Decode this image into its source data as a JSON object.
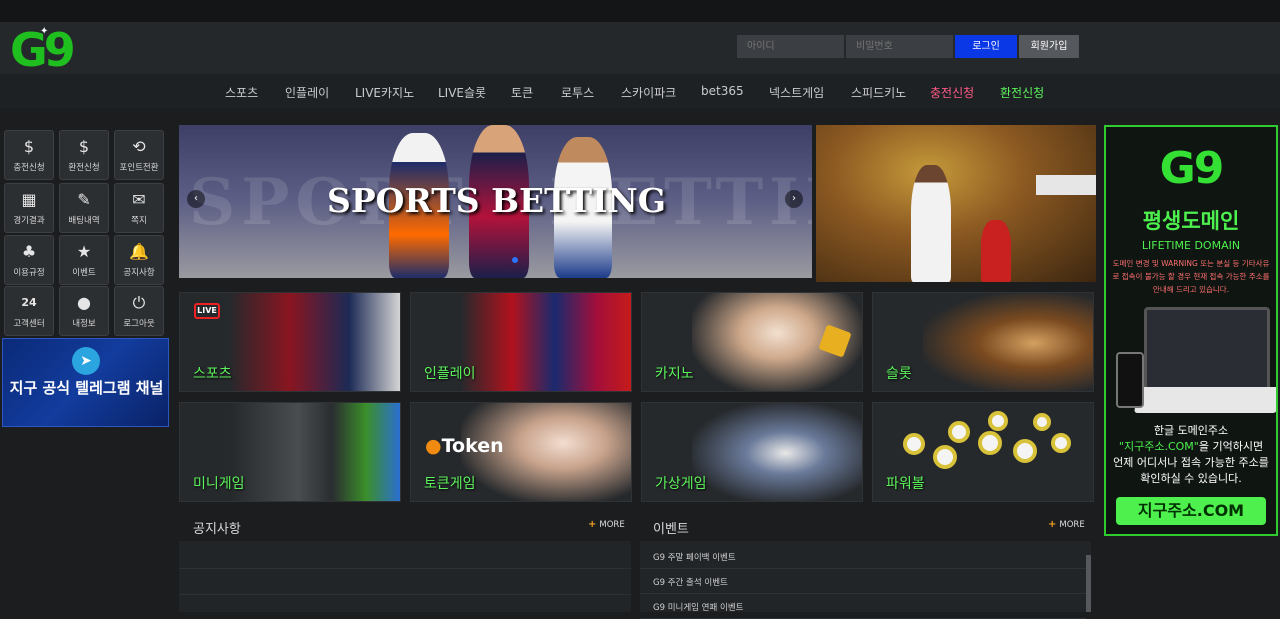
{
  "header": {
    "logo": "G9",
    "id_placeholder": "아이디",
    "pw_placeholder": "비밀번호",
    "login_label": "로그인",
    "join_label": "회원가입"
  },
  "nav": {
    "items": [
      "스포츠",
      "인플레이",
      "LIVE카지노",
      "LIVE슬롯",
      "토큰",
      "로투스",
      "스카이파크",
      "bet365",
      "넥스트게임",
      "스피드키노",
      "충전신청",
      "환전신청"
    ]
  },
  "sidebar": {
    "buttons": [
      {
        "label": "충전신청",
        "icon": "coin-deposit-icon",
        "glyph": "$"
      },
      {
        "label": "환전신청",
        "icon": "exchange-icon",
        "glyph": "$"
      },
      {
        "label": "포인트전환",
        "icon": "point-convert-icon",
        "glyph": "⟲"
      },
      {
        "label": "경기결과",
        "icon": "calendar-icon",
        "glyph": "▦"
      },
      {
        "label": "배팅내역",
        "icon": "bet-history-icon",
        "glyph": "✎"
      },
      {
        "label": "쪽지",
        "icon": "mail-icon",
        "glyph": "✉"
      },
      {
        "label": "이용규정",
        "icon": "clover-icon",
        "glyph": "♣"
      },
      {
        "label": "이벤트",
        "icon": "star-icon",
        "glyph": "★"
      },
      {
        "label": "공지사항",
        "icon": "bell-icon",
        "glyph": "🔔"
      },
      {
        "label": "고객센터",
        "icon": "support-24-7-icon",
        "glyph": "24"
      },
      {
        "label": "내정보",
        "icon": "user-icon",
        "glyph": "●"
      },
      {
        "label": "로그아웃",
        "icon": "power-icon",
        "glyph": "⏻"
      }
    ],
    "telegram_banner": "지구 공식 텔레그램 채널"
  },
  "slider": {
    "title": "SPORTS BETTING",
    "bg_text": "SPORTS BETTING",
    "prev": "‹",
    "next": "›"
  },
  "cards": [
    {
      "label": "스포츠",
      "live": "LIVE"
    },
    {
      "label": "인플레이"
    },
    {
      "label": "카지노"
    },
    {
      "label": "슬롯"
    },
    {
      "label": "미니게임"
    },
    {
      "label": "토큰게임",
      "brand": "Token"
    },
    {
      "label": "가상게임"
    },
    {
      "label": "파워볼"
    }
  ],
  "right_banner": {
    "logo": "G9",
    "title": "평생도메인",
    "subtitle": "LIFETIME DOMAIN",
    "warning": "도메인 변경 및 WARNING 또는 분실 등 기타사유로 접속이 불가능 할 경우 현재 접속 가능한 주소를 안내해 드리고 있습니다.",
    "info_line1": "한글 도메인주소",
    "info_line2_hl": "\"지구주소.COM\"",
    "info_line2": "을 기억하시면",
    "info_line3": "언제 어디서나 접속 가능한 주소를",
    "info_line4": "확인하실 수 있습니다.",
    "url": "지구주소.COM"
  },
  "notice": {
    "title": "공지사항",
    "more": "MORE"
  },
  "events": {
    "title": "이벤트",
    "more": "MORE",
    "items": [
      "G9 주말 페이백 이벤트",
      "G9 주간 출석 이벤트",
      "G9 미니게임 연패 이벤트"
    ]
  },
  "colors": {
    "accent_green": "#5cf45c",
    "accent_pink": "#ff5a86",
    "login_blue": "#0a38e6"
  }
}
